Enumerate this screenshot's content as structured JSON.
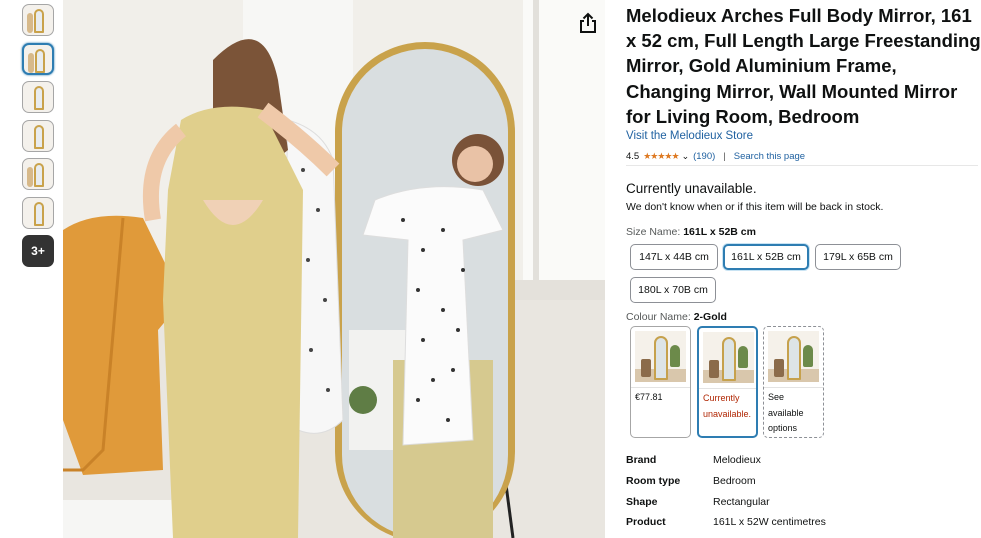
{
  "gallery": {
    "thumbnails": [
      "thumb-1",
      "thumb-2",
      "thumb-3",
      "thumb-4",
      "thumb-5",
      "thumb-6"
    ],
    "active_index": 1,
    "more_label": "3+"
  },
  "product": {
    "title": "Melodieux Arches Full Body Mirror, 161 x 52 cm, Full Length Large Freestanding Mirror, Gold Aluminium Frame, Changing Mirror, Wall Mounted Mirror for Living Room, Bedroom",
    "store_link": "Visit the Melodieux Store",
    "rating_value": "4.5",
    "stars": "★★★★★",
    "rating_count": "(190)",
    "search_link": "Search this page"
  },
  "availability": {
    "status": "Currently unavailable.",
    "note": "We don't know when or if this item will be back in stock."
  },
  "size": {
    "label": "Size Name:",
    "selected": "161L x 52B cm",
    "options": [
      "147L x 44B cm",
      "161L x 52B cm",
      "179L x 65B cm",
      "180L x 70B cm"
    ]
  },
  "colour": {
    "label": "Colour Name:",
    "selected": "2-Gold",
    "options": [
      {
        "line1": "€77.81",
        "line2": ""
      },
      {
        "line1": "Currently",
        "line2": "unavailable."
      },
      {
        "line1": "See",
        "line2": "available",
        "line3": "options"
      }
    ]
  },
  "specs": [
    {
      "key": "Brand",
      "value": "Melodieux"
    },
    {
      "key": "Room type",
      "value": "Bedroom"
    },
    {
      "key": "Shape",
      "value": "Rectangular"
    },
    {
      "key": "Product",
      "value": "161L x 52W centimetres"
    }
  ],
  "colors": {
    "link": "#2162a1",
    "stars": "#de7921",
    "selected_border": "#2e7db2",
    "unavailable_red": "#b12704",
    "frame_gold": "#c9a24b"
  }
}
